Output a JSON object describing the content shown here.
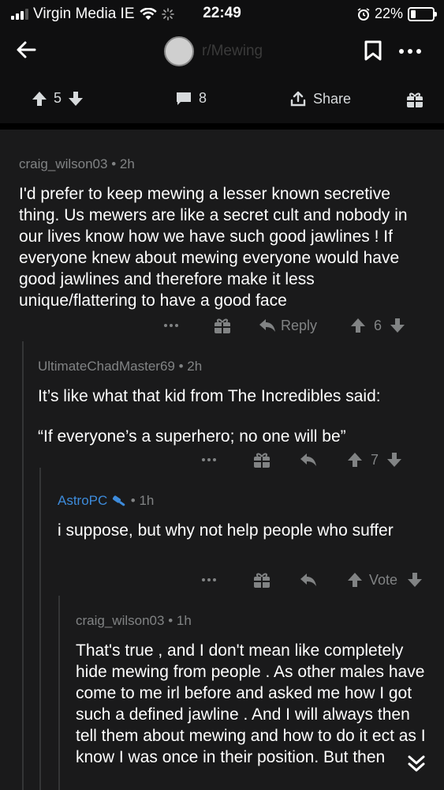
{
  "status_bar": {
    "carrier": "Virgin Media IE",
    "time": "22:49",
    "battery": "22%"
  },
  "nav": {
    "subreddit": "r/Mewing"
  },
  "post_actions": {
    "upvotes": "5",
    "comments": "8",
    "share_label": "Share"
  },
  "comments": [
    {
      "author": "craig_wilson03",
      "age": "2h",
      "body": "I'd prefer to keep mewing a lesser known secretive thing. Us mewers are like a secret cult and nobody in our lives know how we have such good jawlines ! If everyone knew about mewing everyone would have good jawlines and therefore make it less unique/flattering to have a good face",
      "reply_label": "Reply",
      "score": "6"
    },
    {
      "author": "UltimateChadMaster69",
      "age": "2h",
      "body_line1": "It’s like what that kid from The Incredibles said:",
      "body_line2": "“If everyone’s a superhero; no one will be”",
      "score": "7"
    },
    {
      "author": "AstroPC",
      "age": "1h",
      "body": "i suppose, but why not help people who suffer",
      "vote_label": "Vote"
    },
    {
      "author": "craig_wilson03",
      "age": "1h",
      "body": "That's true , and I don't mean like completely hide mewing from people . As other males have come to me irl before and asked me how I got such a defined jawline . And I will always then tell them about mewing and how to do it ect as I know I was once in their position. But then"
    }
  ],
  "colors": {
    "background": "#1a1a1b",
    "bar": "#0f0f10",
    "text": "#ffffff",
    "muted": "#818384",
    "mod_blue": "#3d8bdb"
  }
}
